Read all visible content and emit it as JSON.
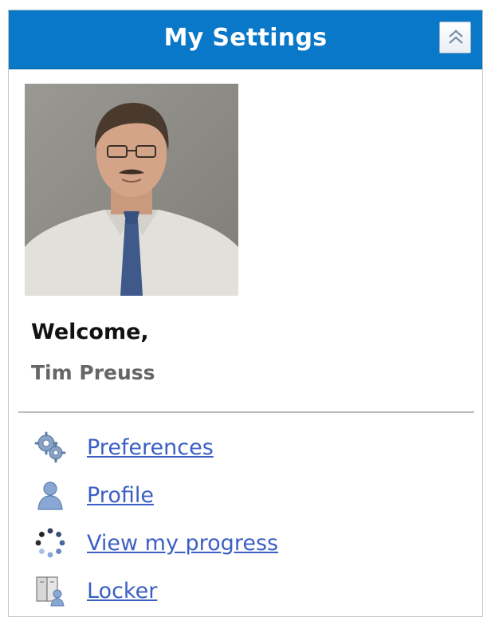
{
  "panel": {
    "title": "My Settings",
    "collapse_icon": "double-chevron-up-icon"
  },
  "user": {
    "welcome": "Welcome,",
    "name": "Tim Preuss"
  },
  "menu": [
    {
      "label": "Preferences",
      "icon": "gears-icon"
    },
    {
      "label": "Profile",
      "icon": "person-icon"
    },
    {
      "label": "View my progress",
      "icon": "progress-spinner-icon"
    },
    {
      "label": "Locker",
      "icon": "locker-icon"
    }
  ],
  "colors": {
    "header": "#0a78c8",
    "link": "#3b5fc4",
    "muted": "#666666"
  }
}
